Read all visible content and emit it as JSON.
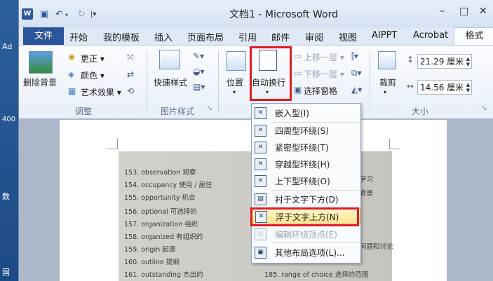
{
  "desktop": {
    "labels": [
      "Ad",
      "400",
      "数",
      "国"
    ]
  },
  "window": {
    "title": "文档1 - Microsoft Word",
    "app_logo": "W",
    "controls": {
      "minimize": "–",
      "maximize": "□",
      "close": "✕"
    }
  },
  "quick_access": {
    "undo": "↶",
    "redo": "↻",
    "customize": "|▾"
  },
  "tabs": {
    "file": "文件",
    "home": "开始",
    "templates": "我的模板",
    "insert": "插入",
    "layout": "页面布局",
    "references": "引用",
    "mail": "邮件",
    "review": "审阅",
    "view": "视图",
    "aippt": "AIPPT",
    "acrobat": "Acrobat",
    "format": "格式"
  },
  "ribbon": {
    "remove_bg": "删除背景",
    "corrections": "更正 ▾",
    "color": "颜色 ▾",
    "artistic": "艺术效果 ▾",
    "group_adjust": "调整",
    "quick_styles": "快速样式",
    "group_styles": "图片样式",
    "position": "位置",
    "wrap_text": "自动换行",
    "bring_forward": "上移一层 ▾",
    "send_backward": "下移一层 ▾",
    "selection_pane": "选择窗格",
    "crop": "裁剪",
    "height_value": "21.29 厘米",
    "width_value": "14.56 厘米",
    "group_size": "大小"
  },
  "menu": {
    "items": [
      "嵌入型(I)",
      "四周型环绕(S)",
      "紧密型环绕(T)",
      "穿越型环绕(H)",
      "上下型环绕(O)",
      "衬于文字下方(D)",
      "浮于文字上方(N)",
      "编辑环绕顶点(E)",
      "其他布局选项(L)..."
    ]
  },
  "doc": {
    "left_lines": [
      "153. observation  观察",
      "154. occupancy  使用 / 居住",
      "155. opportunity  机会",
      "156. optional  可选择的",
      "157. organization  组织",
      "158. organized  有组织的",
      "159. origin  起源",
      "160. outline  提纲",
      "161. outstanding  杰出的"
    ],
    "right_lines": [
      "学习",
      "背景",
      "问题和讨论",
      "185. range of choice  选择的范围"
    ]
  }
}
